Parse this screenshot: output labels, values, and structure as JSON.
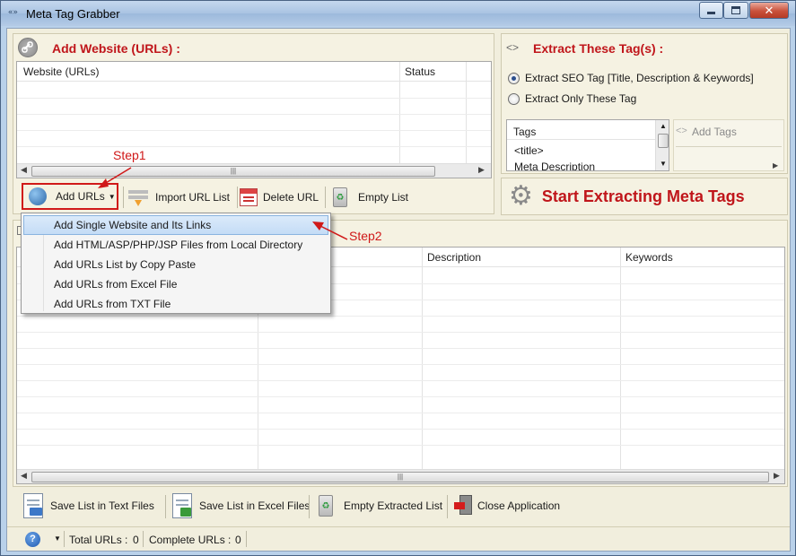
{
  "window": {
    "title": "Meta Tag Grabber",
    "app_icon": "«»"
  },
  "add_website": {
    "title": "Add Website (URLs) :",
    "columns": [
      "Website (URLs)",
      "Status"
    ]
  },
  "extract": {
    "title": "Extract These Tag(s) :",
    "radio_seo": "Extract SEO Tag [Title, Description & Keywords]",
    "radio_only": "Extract Only These Tag",
    "tags_header": "Tags",
    "tags": [
      "<title>",
      "Meta Description"
    ],
    "add_tags": "Add Tags",
    "start_button": "Start Extracting Meta Tags"
  },
  "url_toolbar": {
    "add_urls": "Add URLs",
    "import_list": "Import URL List",
    "delete_url": "Delete URL",
    "empty_list": "Empty List"
  },
  "add_menu": {
    "items": [
      "Add Single Website and Its Links",
      "Add HTML/ASP/PHP/JSP Files from Local Directory",
      "Add URLs List by Copy Paste",
      "Add URLs from Excel File",
      "Add URLs from TXT File"
    ]
  },
  "annotations": {
    "step1": "Step1",
    "step2": "Step2"
  },
  "results": {
    "columns": [
      "Description",
      "Keywords"
    ]
  },
  "bottom_toolbar": {
    "save_text": "Save List in Text Files",
    "save_excel": "Save List in Excel Files",
    "empty_extracted": "Empty Extracted List",
    "close_app": "Close Application"
  },
  "status": {
    "total_label": "Total URLs :",
    "total_value": "0",
    "complete_label": "Complete URLs :",
    "complete_value": "0"
  },
  "colors": {
    "accent_red": "#c0161b",
    "annotation_red": "#d01919",
    "highlight": "#c4dcf6"
  }
}
